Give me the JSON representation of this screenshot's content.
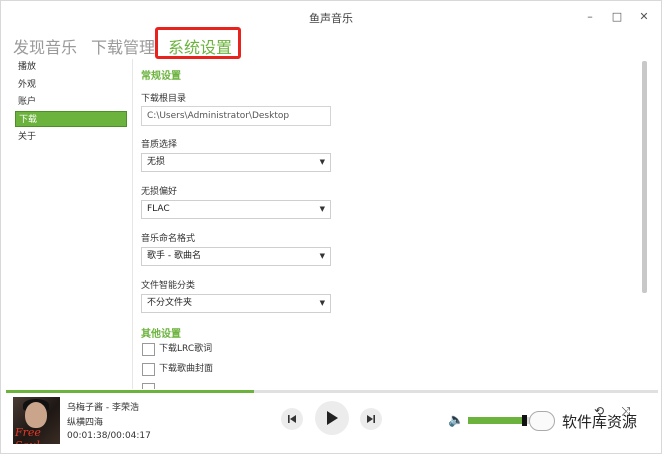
{
  "window": {
    "title": "鱼声音乐"
  },
  "titlebar": {
    "minimize": "–",
    "maximize": "□",
    "close": "✕"
  },
  "tabs": [
    {
      "label": "发现音乐"
    },
    {
      "label": "下载管理"
    },
    {
      "label": "系统设置"
    }
  ],
  "sidebar": {
    "items": [
      {
        "label": "播放"
      },
      {
        "label": "外观"
      },
      {
        "label": "账户"
      },
      {
        "label": "下载"
      },
      {
        "label": "关于"
      }
    ]
  },
  "settings": {
    "general_title": "常规设置",
    "download_dir": {
      "label": "下载根目录",
      "value": "C:\\Users\\Administrator\\Desktop"
    },
    "quality": {
      "label": "音质选择",
      "value": "无损"
    },
    "lossless_pref": {
      "label": "无损偏好",
      "value": "FLAC"
    },
    "naming": {
      "label": "音乐命名格式",
      "value": "歌手 - 歌曲名"
    },
    "folder": {
      "label": "文件智能分类",
      "value": "不分文件夹"
    },
    "other_title": "其他设置",
    "options": [
      {
        "label": "下载LRC歌词",
        "checked": false
      },
      {
        "label": "下载歌曲封面",
        "checked": false
      }
    ]
  },
  "player": {
    "song_title": "乌梅子酱 - 李荣浩",
    "album": "纵横四海",
    "time": "00:01:38/00:04:17",
    "progress": 0.38,
    "volume": 0.9,
    "cover_text": "Free Soul",
    "controls": {
      "prev": "prev-icon",
      "play": "play-icon",
      "next": "next-icon"
    }
  },
  "watermark": {
    "text": "软件库资源"
  },
  "colors": {
    "accent": "#6cb33e",
    "highlight": "#e8231e"
  }
}
